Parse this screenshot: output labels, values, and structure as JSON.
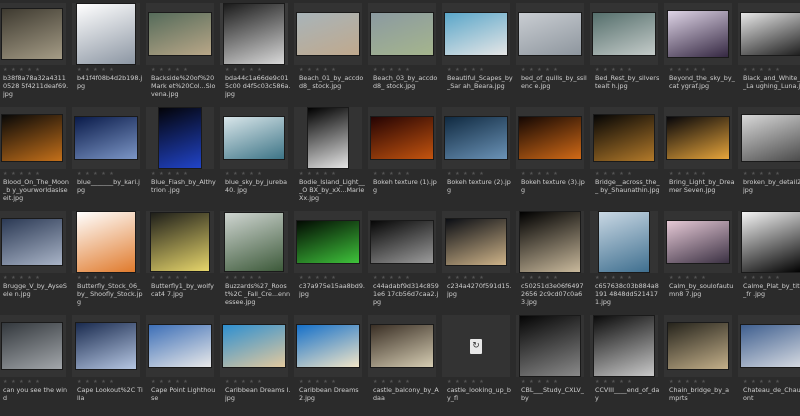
{
  "thumbnails": [
    {
      "label": "b38f8a78a32a43110528 5f4211deaf69.jpg",
      "colors": [
        "#3e3a30",
        "#a59c86"
      ],
      "w": 60,
      "h": 50
    },
    {
      "label": "b41f4f08b4d2b198.jpg",
      "colors": [
        "#ffffff",
        "#8c96a3"
      ],
      "w": 58,
      "h": 60
    },
    {
      "label": "Backside%20of%20Mark et%20Col...Slovena.jpg",
      "colors": [
        "#556b5a",
        "#b9a788"
      ],
      "w": 62,
      "h": 42
    },
    {
      "label": "bda44c1a66de9c015c00 d4f5c03c586a.jpg",
      "colors": [
        "#1b1b1b",
        "#d9d9d9"
      ],
      "w": 60,
      "h": 60
    },
    {
      "label": "Beach_01_by_accdod8_ stock.jpg",
      "colors": [
        "#a8b4b9",
        "#c0a98d"
      ],
      "w": 62,
      "h": 42
    },
    {
      "label": "Beach_03_by_accdod8_ stock.jpg",
      "colors": [
        "#8b9aa1",
        "#a5b58d"
      ],
      "w": 62,
      "h": 42
    },
    {
      "label": "Beautiful_Scapes_by_Sar ah_Beara.jpg",
      "colors": [
        "#5aa6c9",
        "#e6e6e6"
      ],
      "w": 62,
      "h": 42
    },
    {
      "label": "bed_of_quills_by_ssilenc e.jpg",
      "colors": [
        "#c9cdd2",
        "#8e969e"
      ],
      "w": 62,
      "h": 42
    },
    {
      "label": "Bed_Rest_by_silverstealt h.jpg",
      "colors": [
        "#556f6c",
        "#c4cbc9"
      ],
      "w": 62,
      "h": 42
    },
    {
      "label": "Beyond_the_sky_by_cat ygraf.jpg",
      "colors": [
        "#ded4e6",
        "#352842"
      ],
      "w": 60,
      "h": 46
    },
    {
      "label": "Black_and_White_by_La ughing_Luna.jpg",
      "colors": [
        "#e8e8e8",
        "#1c1c1c"
      ],
      "w": 62,
      "h": 42
    },
    {
      "label": "Blood_On_The_Moon_b y_yourworldasiseeit.jpg",
      "colors": [
        "#080808",
        "#c4701a"
      ],
      "w": 60,
      "h": 46
    },
    {
      "label": "blue_______by_kari.jpg",
      "colors": [
        "#0a1b4a",
        "#7c96c6"
      ],
      "w": 62,
      "h": 42
    },
    {
      "label": "Blue_Flash_by_Althytrion .jpg",
      "colors": [
        "#030308",
        "#2144c9"
      ],
      "w": 42,
      "h": 60
    },
    {
      "label": "blue_sky_by_jureba40. jpg",
      "colors": [
        "#d9e6ea",
        "#3d7486"
      ],
      "w": 60,
      "h": 42
    },
    {
      "label": "Bodie_Island_Light___O BX_by_xX...MarieXx.jpg",
      "colors": [
        "#000000",
        "#e6e6e6"
      ],
      "w": 40,
      "h": 60
    },
    {
      "label": "Bokeh texture (1).jpg",
      "colors": [
        "#250303",
        "#c4540f"
      ],
      "w": 62,
      "h": 42
    },
    {
      "label": "Bokeh texture (2).jpg",
      "colors": [
        "#102a41",
        "#6b93b7"
      ],
      "w": 62,
      "h": 42
    },
    {
      "label": "Bokeh texture (3).jpg",
      "colors": [
        "#140703",
        "#d16a17"
      ],
      "w": 62,
      "h": 42
    },
    {
      "label": "Bridge__across_the__ by_Shaunathin.jpg",
      "colors": [
        "#050505",
        "#b37a2a"
      ],
      "w": 60,
      "h": 46
    },
    {
      "label": "Bring_Light_by_Dreamer Seven.jpg",
      "colors": [
        "#06060a",
        "#e7a53b"
      ],
      "w": 62,
      "h": 42
    },
    {
      "label": "broken_by_detail24.jpg",
      "colors": [
        "#d8d8d8",
        "#4a4a4a"
      ],
      "w": 60,
      "h": 46
    },
    {
      "label": "Brugge_V_by_AyseSele n.jpg",
      "colors": [
        "#2b3954",
        "#a9b4c7"
      ],
      "w": 60,
      "h": 46
    },
    {
      "label": "Butterfly_Stock_06_by_ Shoofly_Stock.jpg",
      "colors": [
        "#ffffff",
        "#e07a2c"
      ],
      "w": 58,
      "h": 60
    },
    {
      "label": "Butterfly1_by_wolfycat4 7.jpg",
      "colors": [
        "#1f1f1a",
        "#e7d66b"
      ],
      "w": 58,
      "h": 58
    },
    {
      "label": "Buzzards%27_Roost%2C _Fall_Cre...ennessee.jpg",
      "colors": [
        "#cfd5d1",
        "#3d5a3a"
      ],
      "w": 58,
      "h": 58
    },
    {
      "label": "c37a975e15aa8bd9.jpg",
      "colors": [
        "#020a02",
        "#3fc43b"
      ],
      "w": 62,
      "h": 42
    },
    {
      "label": "c44adabf9d314c8591e6 17cb56d7caa2.jpg",
      "colors": [
        "#060606",
        "#9c9c9c"
      ],
      "w": 62,
      "h": 42
    },
    {
      "label": "c234a4270f591d15.jpg",
      "colors": [
        "#0b0e14",
        "#cfb489"
      ],
      "w": 60,
      "h": 46
    },
    {
      "label": "c50251d3e06f64972656 2c9cd07c0a63.jpg",
      "colors": [
        "#000000",
        "#c9b99c"
      ],
      "w": 60,
      "h": 60
    },
    {
      "label": "c657638c03b884a8191 4848dd5214171.jpg",
      "colors": [
        "#c9d8e4",
        "#3f6f8f"
      ],
      "w": 50,
      "h": 60
    },
    {
      "label": "Calm_by_soulofautumn8 7.jpg",
      "colors": [
        "#e6c9d6",
        "#3b3143"
      ],
      "w": 62,
      "h": 42
    },
    {
      "label": "Calme_Plat_by_titus_fr .jpg",
      "colors": [
        "#f5f5f5",
        "#000000"
      ],
      "w": 60,
      "h": 60
    },
    {
      "label": "can you see the wind",
      "colors": [
        "#33383d",
        "#a3a7ab"
      ],
      "w": 60,
      "h": 46
    },
    {
      "label": "Cape Lookout%2C Tilla",
      "colors": [
        "#1a2b4f",
        "#b6c7e3"
      ],
      "w": 60,
      "h": 46
    },
    {
      "label": "Cape Point Lighthouse",
      "colors": [
        "#3d6fb7",
        "#e9e9e9"
      ],
      "w": 62,
      "h": 42
    },
    {
      "label": "Caribbean Dreams I.jpg",
      "colors": [
        "#2e8fd0",
        "#e3c99e"
      ],
      "w": 62,
      "h": 42
    },
    {
      "label": "Caribbean Dreams 2.jpg",
      "colors": [
        "#1570c9",
        "#f2e6c8"
      ],
      "w": 62,
      "h": 42
    },
    {
      "label": "castle_balcony_by_Adaa",
      "colors": [
        "#3a2f25",
        "#d6cdb3"
      ],
      "w": 62,
      "h": 42
    },
    {
      "label": "castle_looking_up_by_fl",
      "colors": [],
      "w": 0,
      "h": 0,
      "icon": "file-icon"
    },
    {
      "label": "CBL___Study_CXLV_by",
      "colors": [
        "#050505",
        "#8a8a8a"
      ],
      "w": 60,
      "h": 60
    },
    {
      "label": "CCVIII____end_of_day",
      "colors": [
        "#0b0b0b",
        "#c9c9c9"
      ],
      "w": 60,
      "h": 60
    },
    {
      "label": "Chain_bridge_by_amprts",
      "colors": [
        "#26241c",
        "#c4b08a"
      ],
      "w": 60,
      "h": 46
    },
    {
      "label": "Chateau_de_Chaumont",
      "colors": [
        "#3f5f8f",
        "#d7dbe2"
      ],
      "w": 62,
      "h": 42
    }
  ],
  "rating_glyphs": "★ ★ ★ ★ ★",
  "selected_index": 3
}
